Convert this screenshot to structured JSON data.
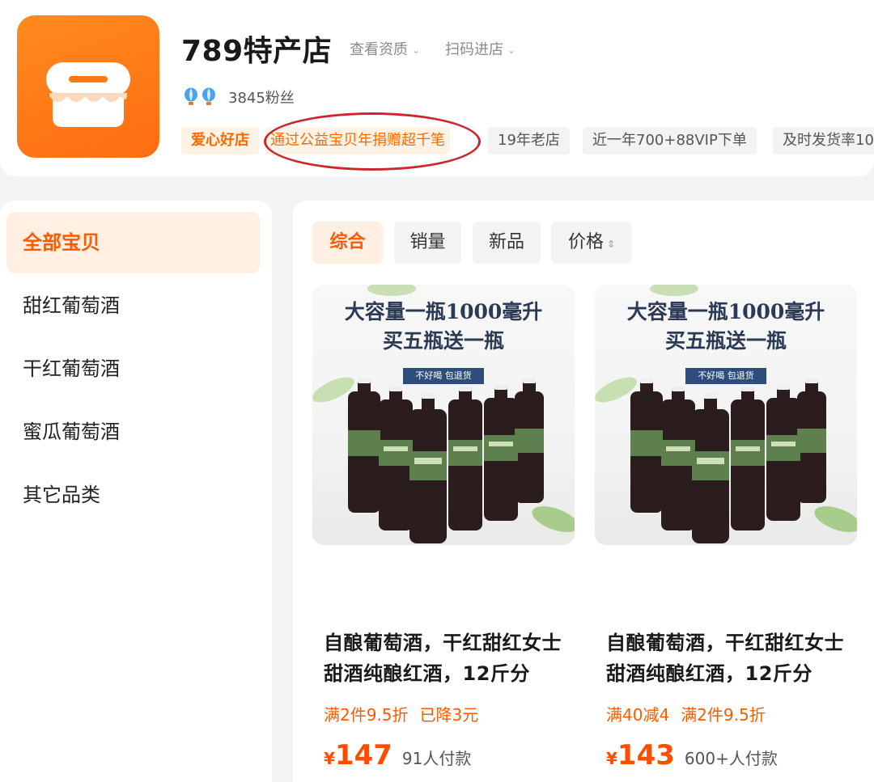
{
  "shop": {
    "name": "789特产店",
    "view_license": "查看资质",
    "scan_enter": "扫码进店",
    "fans": "3845粉丝",
    "tags": [
      "爱心好店",
      "通过公益宝贝年捐赠超千笔",
      "19年老店",
      "近一年700+88VIP下单",
      "及时发货率10"
    ]
  },
  "sidebar": {
    "items": [
      {
        "label": "全部宝贝",
        "active": true
      },
      {
        "label": "甜红葡萄酒"
      },
      {
        "label": "干红葡萄酒"
      },
      {
        "label": "蜜瓜葡萄酒"
      },
      {
        "label": "其它品类"
      }
    ]
  },
  "sort": {
    "options": [
      "综合",
      "销量",
      "新品",
      "价格"
    ]
  },
  "products": [
    {
      "img_line1": "大容量一瓶1000毫升",
      "img_line2": "买五瓶送一瓶",
      "img_badge": "不好喝 包退货",
      "title": "自酿葡萄酒，干红甜红女士甜酒纯酿红酒，12斤分",
      "promo1": "满2件9.5折",
      "promo2": "已降3元",
      "currency": "¥",
      "price": "147",
      "sold": "91人付款"
    },
    {
      "img_line1": "大容量一瓶1000毫升",
      "img_line2": "买五瓶送一瓶",
      "img_badge": "不好喝 包退货",
      "title": "自酿葡萄酒，干红甜红女士甜酒纯酿红酒，12斤分",
      "promo1": "满40减4",
      "promo2": "满2件9.5折",
      "currency": "¥",
      "price": "143",
      "sold": "600+人付款"
    }
  ],
  "colors": {
    "accent": "#ff5a00",
    "logo": "#ff7a17",
    "highlight_circle": "#c9282d"
  }
}
